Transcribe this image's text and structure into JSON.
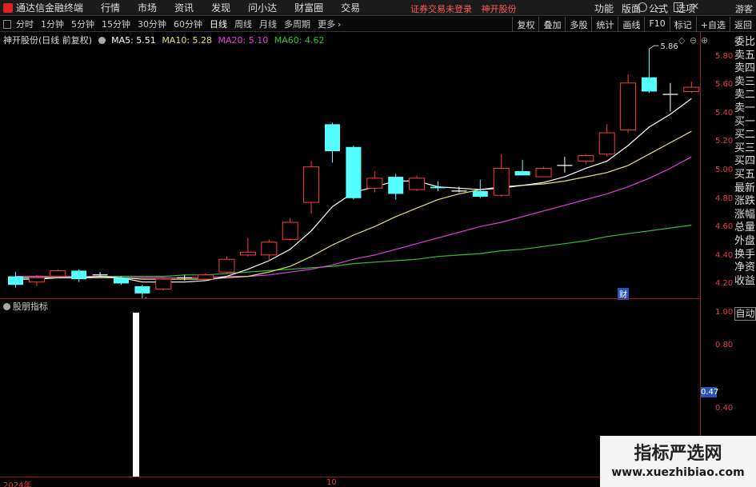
{
  "menubar": {
    "app_title": "通达信金融终端",
    "items": [
      "行情",
      "市场",
      "资讯",
      "发现",
      "问小达",
      "财富圈",
      "交易"
    ],
    "status": [
      "证券交易未登录",
      "神开股份"
    ],
    "right_items": [
      "功能",
      "版面",
      "公式",
      "选项"
    ],
    "guest": "游客"
  },
  "periodbar": {
    "periods": [
      "分时",
      "1分钟",
      "5分钟",
      "15分钟",
      "30分钟",
      "60分钟",
      "日线",
      "周线",
      "月线",
      "多周期",
      "更多"
    ],
    "active": "日线",
    "tools": [
      "复权",
      "叠加",
      "多股",
      "统计",
      "画线",
      "F10",
      "标记",
      "+自选",
      "返回"
    ]
  },
  "info": {
    "stock": "神开股份(日线 前复权)",
    "ma5": "MA5: 5.51",
    "ma10": "MA10: 5.28",
    "ma20": "MA20: 5.10",
    "ma60": "MA60: 4.62",
    "colors": {
      "ma5": "#ffffff",
      "ma10": "#e8e070",
      "ma20": "#e040e0",
      "ma60": "#30c030"
    }
  },
  "price_axis": [
    "5.80",
    "5.60",
    "5.40",
    "5.20",
    "5.00",
    "4.80",
    "4.60",
    "4.40",
    "4.20"
  ],
  "annotations": {
    "high": "5.86",
    "low": "4.09",
    "cai": "财"
  },
  "sidelist": [
    "委比",
    "卖五",
    "卖四",
    "卖三",
    "卖二",
    "卖一",
    "买一",
    "买二",
    "买三",
    "买四",
    "买五",
    "最新",
    "涨跌",
    "涨幅",
    "总量",
    "外盘",
    "换手",
    "净资",
    "收益"
  ],
  "auto_label": "自动",
  "sub_chart": {
    "title": "股朋指标",
    "axis": [
      "1.00",
      "0.80",
      "0.40"
    ],
    "current": "0.47"
  },
  "dates": [
    "2024年",
    "10"
  ],
  "watermark": {
    "main": "指标严选网",
    "sub": "www.xuezhibiao.com"
  },
  "chart_data": {
    "type": "candlestick",
    "ylim": [
      4.1,
      5.9
    ],
    "candles": [
      {
        "o": 4.26,
        "c": 4.2,
        "h": 4.29,
        "l": 4.18
      },
      {
        "o": 4.22,
        "c": 4.25,
        "h": 4.27,
        "l": 4.19
      },
      {
        "o": 4.26,
        "c": 4.3,
        "h": 4.31,
        "l": 4.25
      },
      {
        "o": 4.3,
        "c": 4.24,
        "h": 4.31,
        "l": 4.22
      },
      {
        "o": 4.27,
        "c": 4.27,
        "h": 4.29,
        "l": 4.26
      },
      {
        "o": 4.25,
        "c": 4.21,
        "h": 4.26,
        "l": 4.2
      },
      {
        "o": 4.19,
        "c": 4.14,
        "h": 4.2,
        "l": 4.09
      },
      {
        "o": 4.17,
        "c": 4.24,
        "h": 4.25,
        "l": 4.16
      },
      {
        "o": 4.25,
        "c": 4.25,
        "h": 4.27,
        "l": 4.23
      },
      {
        "o": 4.24,
        "c": 4.27,
        "h": 4.28,
        "l": 4.23
      },
      {
        "o": 4.29,
        "c": 4.38,
        "h": 4.4,
        "l": 4.28
      },
      {
        "o": 4.41,
        "c": 4.43,
        "h": 4.53,
        "l": 4.4
      },
      {
        "o": 4.41,
        "c": 4.5,
        "h": 4.52,
        "l": 4.37
      },
      {
        "o": 4.52,
        "c": 4.64,
        "h": 4.67,
        "l": 4.51
      },
      {
        "o": 4.78,
        "c": 5.03,
        "h": 5.07,
        "l": 4.7
      },
      {
        "o": 5.33,
        "c": 5.14,
        "h": 5.34,
        "l": 5.06
      },
      {
        "o": 5.17,
        "c": 4.81,
        "h": 5.18,
        "l": 4.8
      },
      {
        "o": 4.88,
        "c": 4.95,
        "h": 5.0,
        "l": 4.85
      },
      {
        "o": 4.96,
        "c": 4.84,
        "h": 4.98,
        "l": 4.8
      },
      {
        "o": 4.87,
        "c": 4.95,
        "h": 4.97,
        "l": 4.86
      },
      {
        "o": 4.89,
        "c": 4.88,
        "h": 4.93,
        "l": 4.86
      },
      {
        "o": 4.86,
        "c": 4.86,
        "h": 4.89,
        "l": 4.85
      },
      {
        "o": 4.86,
        "c": 4.82,
        "h": 4.94,
        "l": 4.81
      },
      {
        "o": 4.83,
        "c": 5.02,
        "h": 5.12,
        "l": 4.82
      },
      {
        "o": 5.0,
        "c": 4.97,
        "h": 5.08,
        "l": 4.97
      },
      {
        "o": 4.96,
        "c": 5.02,
        "h": 5.03,
        "l": 4.96
      },
      {
        "o": 5.04,
        "c": 5.04,
        "h": 5.1,
        "l": 4.99
      },
      {
        "o": 5.07,
        "c": 5.11,
        "h": 5.12,
        "l": 5.05
      },
      {
        "o": 5.12,
        "c": 5.27,
        "h": 5.33,
        "l": 5.1
      },
      {
        "o": 5.29,
        "c": 5.62,
        "h": 5.68,
        "l": 5.27
      },
      {
        "o": 5.66,
        "c": 5.56,
        "h": 5.86,
        "l": 5.55
      },
      {
        "o": 5.54,
        "c": 5.54,
        "h": 5.62,
        "l": 5.42
      },
      {
        "o": 5.56,
        "c": 5.59,
        "h": 5.63,
        "l": 5.55
      }
    ],
    "ma5": [
      4.24,
      4.24,
      4.25,
      4.25,
      4.26,
      4.25,
      4.22,
      4.22,
      4.22,
      4.23,
      4.26,
      4.31,
      4.37,
      4.45,
      4.58,
      4.75,
      4.85,
      4.89,
      4.93,
      4.93,
      4.89,
      4.88,
      4.87,
      4.88,
      4.9,
      4.92,
      4.96,
      5.02,
      5.07,
      5.18,
      5.31,
      5.4,
      5.51
    ],
    "ma10": [
      4.25,
      4.25,
      4.25,
      4.25,
      4.25,
      4.25,
      4.24,
      4.24,
      4.24,
      4.24,
      4.25,
      4.26,
      4.29,
      4.33,
      4.4,
      4.48,
      4.55,
      4.61,
      4.68,
      4.74,
      4.8,
      4.84,
      4.87,
      4.89,
      4.9,
      4.91,
      4.93,
      4.96,
      4.99,
      5.04,
      5.12,
      5.2,
      5.28
    ],
    "ma20": [
      4.26,
      4.26,
      4.26,
      4.26,
      4.26,
      4.25,
      4.25,
      4.25,
      4.25,
      4.25,
      4.26,
      4.26,
      4.27,
      4.29,
      4.31,
      4.34,
      4.38,
      4.41,
      4.45,
      4.49,
      4.53,
      4.57,
      4.61,
      4.64,
      4.68,
      4.72,
      4.76,
      4.8,
      4.84,
      4.89,
      4.95,
      5.02,
      5.1
    ],
    "ma60": [
      4.26,
      4.26,
      4.26,
      4.26,
      4.26,
      4.26,
      4.26,
      4.26,
      4.27,
      4.27,
      4.28,
      4.29,
      4.3,
      4.31,
      4.32,
      4.33,
      4.35,
      4.36,
      4.37,
      4.38,
      4.4,
      4.41,
      4.42,
      4.44,
      4.45,
      4.47,
      4.49,
      4.51,
      4.54,
      4.56,
      4.58,
      4.6,
      4.62
    ],
    "sub_bar_value": 1.0
  }
}
